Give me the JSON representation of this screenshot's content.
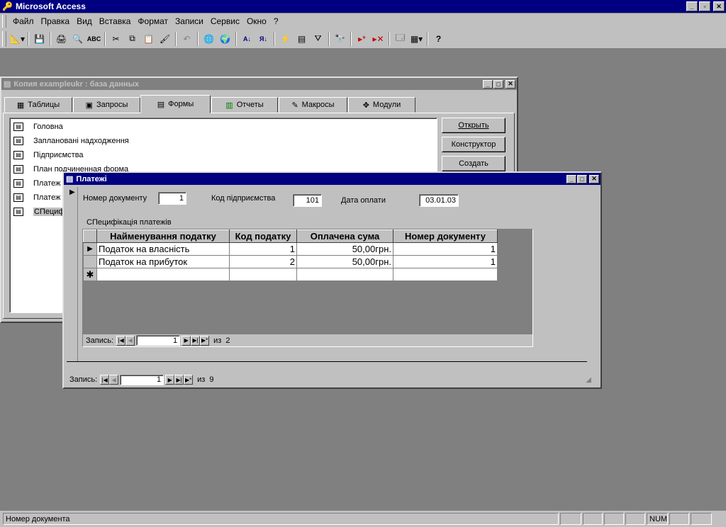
{
  "app": {
    "title": "Microsoft Access"
  },
  "menu": [
    "Файл",
    "Правка",
    "Вид",
    "Вставка",
    "Формат",
    "Записи",
    "Сервис",
    "Окно",
    "?"
  ],
  "db_window": {
    "title": "Копия exampleukr : база данных",
    "tabs": [
      "Таблицы",
      "Запросы",
      "Формы",
      "Отчеты",
      "Макросы",
      "Модули"
    ],
    "active_tab": "Формы",
    "items": [
      "Головна",
      "Заплановані надходження",
      "Підприємства",
      "План подчиненная форма",
      "Платеж",
      "Платеж",
      "СПециф"
    ],
    "buttons": {
      "open": "Открыть",
      "design": "Конструктор",
      "create": "Создать"
    }
  },
  "form": {
    "title": "Платежі",
    "doc_number_label": "Номер документу",
    "doc_number_value": "1",
    "company_code_label": "Код підприємства",
    "company_code_value": "101",
    "pay_date_label": "Дата оплати",
    "pay_date_value": "03.01.03",
    "subform_label": "СПецифікація платежів",
    "columns": [
      "Найменування податку",
      "Код податку",
      "Оплачена сума",
      "Номер документу"
    ],
    "rows": [
      [
        "Податок на власність",
        "1",
        "50,00грн.",
        "1"
      ],
      [
        "Податок на прибуток",
        "2",
        "50,00грн.",
        "1"
      ]
    ],
    "sub_nav": {
      "label": "Запись:",
      "current": "1",
      "of": "из",
      "total": "2"
    },
    "main_nav": {
      "label": "Запись:",
      "current": "1",
      "of": "из",
      "total": "9"
    }
  },
  "status": {
    "text": "Номер документа",
    "num": "NUM"
  },
  "colors": {
    "titlebar": "#000080",
    "inactive_title": "#808080",
    "desktop": "#808080",
    "face": "#c0c0c0"
  }
}
